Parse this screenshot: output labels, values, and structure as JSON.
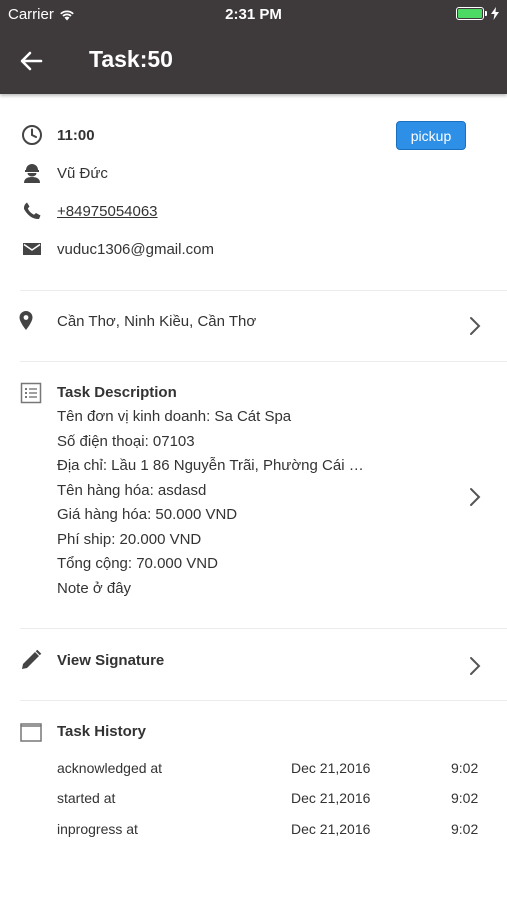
{
  "status_bar": {
    "carrier": "Carrier",
    "time": "2:31 PM",
    "battery_level": 1.0,
    "battery_color": "#4cd964"
  },
  "nav": {
    "title": "Task:50",
    "back_icon": "arrow-left-icon",
    "background": "#3e3a3c"
  },
  "contact": {
    "time": "11:00",
    "pickup_label": "pickup",
    "name": "Vũ Đức",
    "phone": "+84975054063",
    "email": "vuduc1306@gmail.com"
  },
  "location": {
    "address": "Cần Thơ, Ninh Kiều, Cần Thơ"
  },
  "description": {
    "heading": "Task Description",
    "lines": [
      "Tên đơn vị kinh doanh: Sa Cát Spa",
      "Số điện thoại: 07103",
      "Địa chỉ: Lầu 1 86 Nguyễn Trãi, Phường Cái …",
      "Tên hàng hóa: asdasd",
      "Giá hàng hóa: 50.000 VND",
      "Phí ship: 20.000 VND",
      "Tổng cộng: 70.000 VND",
      "Note ở đây"
    ]
  },
  "signature": {
    "label": "View Signature"
  },
  "history": {
    "heading": "Task History",
    "rows": [
      {
        "event": "acknowledged at",
        "date": "Dec 21,2016",
        "time": "9:02"
      },
      {
        "event": "started at",
        "date": "Dec 21,2016",
        "time": "9:02"
      },
      {
        "event": "inprogress at",
        "date": "Dec 21,2016",
        "time": "9:02"
      }
    ]
  },
  "colors": {
    "accent": "#2e8fe6",
    "icon": "#444444"
  }
}
